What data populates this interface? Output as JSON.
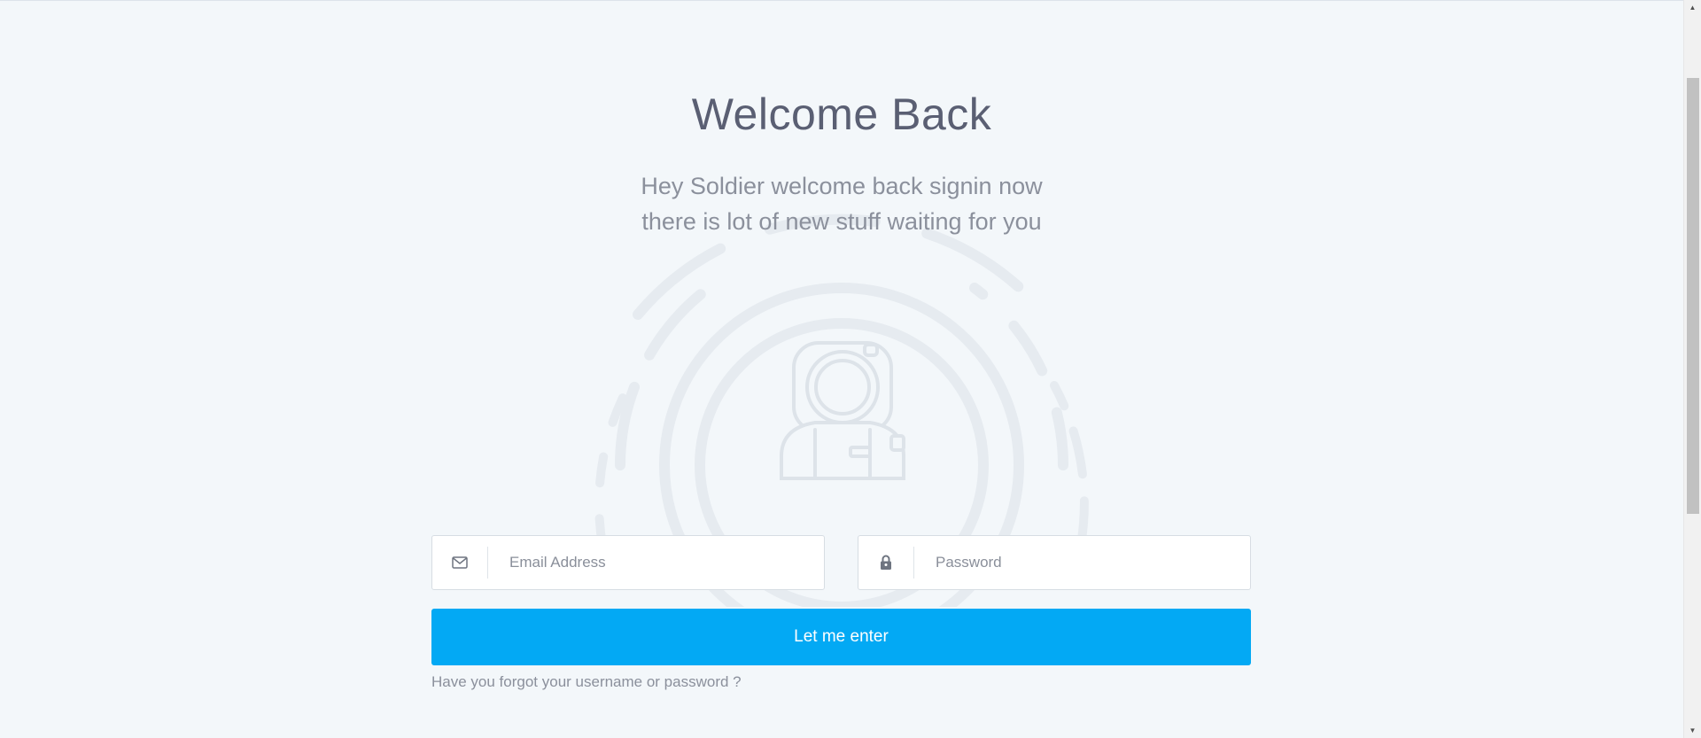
{
  "header": {
    "title": "Welcome Back",
    "subtitle_line1": "Hey Soldier welcome back signin now",
    "subtitle_line2": "there is lot of new stuff waiting for you"
  },
  "illustration": {
    "icon": "astronaut-icon"
  },
  "form": {
    "email": {
      "icon": "mail-icon",
      "placeholder": "Email Address",
      "value": ""
    },
    "password": {
      "icon": "lock-icon",
      "placeholder": "Password",
      "value": ""
    },
    "submit_label": "Let me enter",
    "forgot_label": "Have you forgot your username or password ?"
  },
  "colors": {
    "background": "#f3f7fa",
    "accent": "#03a9f4",
    "title": "#5a5f73",
    "muted": "#8b909c"
  }
}
